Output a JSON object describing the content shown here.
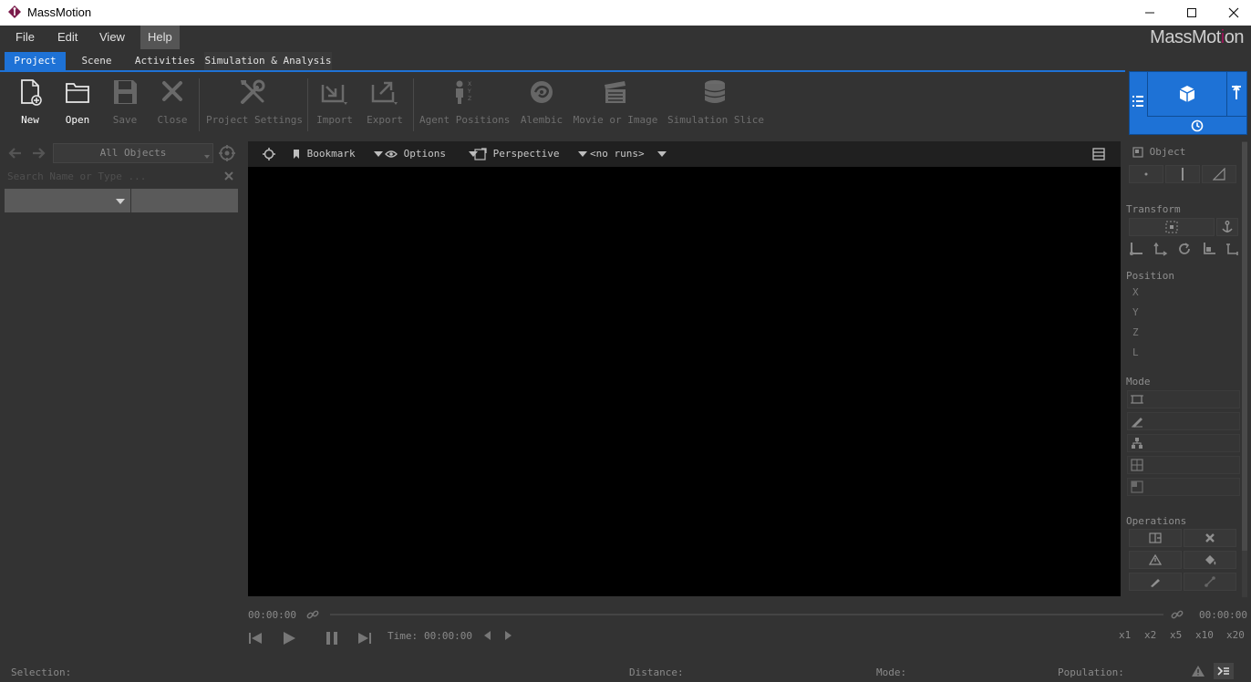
{
  "window": {
    "title": "MassMotion",
    "minimize_icon": "minimize-icon",
    "maximize_icon": "maximize-icon",
    "close_icon": "close-icon"
  },
  "menu": {
    "items": [
      "File",
      "Edit",
      "View",
      "Help"
    ],
    "active": "Help"
  },
  "brand": {
    "part1": "Mass",
    "part2": "Mot",
    "part3": "i",
    "part4": "on",
    "accent_color": "#a0135a"
  },
  "tabs": [
    {
      "label": "Project",
      "active": true
    },
    {
      "label": "Scene",
      "active": false
    },
    {
      "label": "Activities",
      "active": false
    },
    {
      "label": "Simulation & Analysis",
      "active": false
    }
  ],
  "ribbon": {
    "new": "New",
    "open": "Open",
    "save": "Save",
    "close": "Close",
    "project_settings": "Project Settings",
    "import": "Import",
    "export": "Export",
    "agent_positions": "Agent Positions",
    "alembic": "Alembic",
    "movie_or_image": "Movie or Image",
    "simulation_slice": "Simulation Slice"
  },
  "left_panel": {
    "filter_value": "All Objects",
    "search_placeholder": "Search Name or Type ..."
  },
  "viewport": {
    "bookmark": "Bookmark",
    "options": "Options",
    "perspective": "Perspective",
    "runs": "<no runs>"
  },
  "properties": {
    "object": "Object",
    "transform": "Transform",
    "position": "Position",
    "axes": [
      "X",
      "Y",
      "Z",
      "L"
    ],
    "mode": "Mode",
    "operations": "Operations"
  },
  "timeline": {
    "start_time": "00:00:00",
    "end_time": "00:00:00",
    "time_label": "Time:",
    "time_value": "00:00:00",
    "speeds": [
      "x1",
      "x2",
      "x5",
      "x10",
      "x20"
    ]
  },
  "status": {
    "selection": "Selection:",
    "distance": "Distance:",
    "mode": "Mode:",
    "population": "Population:"
  },
  "colors": {
    "accent": "#1e72d6",
    "background": "#333333",
    "viewport": "#000000"
  }
}
